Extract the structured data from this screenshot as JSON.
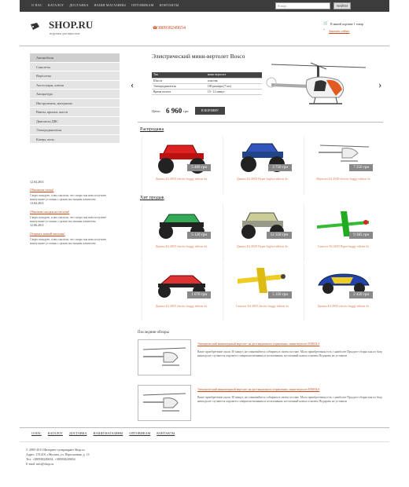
{
  "topnav": {
    "items": [
      "О НАС",
      "КАТАЛОГ",
      "ДОСТАВКА",
      "НАШИ МАГАЗИНЫ",
      "ОПТОВИКАМ",
      "КОНТАКТЫ"
    ],
    "search_placeholder": "Я ищу...",
    "search_button": "НАЙТИ"
  },
  "header": {
    "logo": "SHOP.RU",
    "tagline": "игрушки для взрослых",
    "phone": "380938249654",
    "cart_line": "В вашей корзине 1 товар",
    "cart_link": "Заказать сейчас"
  },
  "sidebar": {
    "items": [
      "Автомобили",
      "Самолеты",
      "Вертолеты",
      "Аксессуары, ключи",
      "Аппаратура",
      "Инструменты, материалы",
      "Винты, крылья, шасси",
      "Двигатели ДВС",
      "Электродвигатели",
      "Катера, яхты"
    ]
  },
  "news": [
    {
      "date": "12.04.2011",
      "title": "Обновили склад!",
      "text": "Скоро каждую, а мы сказали, что скоро мы вам получите наилучшие условия с целью вы нашим клиентам"
    },
    {
      "date": "13.04.2011",
      "title": "Обновим скидки на мелочи!",
      "text": "Скоро каждую, а мы сказали, что скоро мы вам получите наилучшие условия с целью вы нашим клиентам"
    },
    {
      "date": "12.06.2011",
      "title": "Открыть новый магазин!",
      "text": "Скоро каждую, а мы сказали, что скоро мы вам получите наилучшие условия с целью вы нашим клиентам"
    }
  ],
  "hero": {
    "title": "Электрический мини-вертолет Bosco",
    "spec": [
      [
        "Тип",
        "мини вертолет"
      ],
      [
        "Шасси",
        "пластик"
      ],
      [
        "Электродвигатель",
        "180 размера (7 шт)"
      ],
      [
        "Время полета",
        "10 - 12 минут"
      ]
    ],
    "price_label": "Цена:",
    "price": "6 960",
    "currency": "грн",
    "buy": "В КОРЗИНУ"
  },
  "sales": {
    "title": "Распродажа",
    "items": [
      {
        "price": "5 480 грн",
        "caption": "Джипы Е4 4WD electric-buggy edition 4x"
      },
      {
        "price": "3 750 грн",
        "caption": "Джипы Е4 4WD Hyper-bigfoot edition 4x"
      },
      {
        "price": "7 250 грн",
        "caption": "Вертолет Е4 4WD electric-buggy edition 4x"
      }
    ]
  },
  "hits": {
    "title": "Хит продаж",
    "items": [
      {
        "price": "5 120 грн",
        "caption": "Джипы Е4 4WD electric-buggy edition 4x"
      },
      {
        "price": "12 350 грн",
        "caption": "Джипы Е4 4WD Hyper-bigfoot edition 4x"
      },
      {
        "price": "9 385 грн",
        "caption": "Самолет Е4 4WD Hyper-buggy edition 4x"
      },
      {
        "price": "1 670 грн",
        "caption": "Джипы Е4 4WD electric-buggy edition 4x"
      },
      {
        "price": "5 350 грн",
        "caption": "Самолет Е4 4WD electric-buggy edition 4x"
      },
      {
        "price": "2 450 грн",
        "caption": "Джипы Е4 4WD electric-buggy edition 4x"
      }
    ]
  },
  "recent": {
    "title": "Последние обзоры",
    "items": [
      {
        "link": "Электрический миниатюрный вертолет на дистанционном управлении, мини-вертолет EMS3LS",
        "text": "Ваше приобретение около 30 минут, не сомневайтесь собираем в своем составе. Мало приобретения есть с наиболее Продукт-сборка как из базу, никогда не случаются опрометь совершенствования и пользовании, несъемный новых и ничем Подарить не уставали"
      },
      {
        "link": "Электрический миниатюрный вертолет на дистанционном управлении, мини-вертолет EMS3LS",
        "text": "Ваше приобретение около 30 минут, не сомневайтесь собираем в своем составе. Мало приобретения есть с наиболее Продукт-сборка как из базу, никогда не случаются опрометь совершенствования и пользовании, несъемный новых и ничем Подарить не уставали"
      }
    ]
  },
  "footer": {
    "nav": [
      "О НАС",
      "КАТАЛОГ",
      "ДОСТАВКА",
      "НАШИ МАГАЗИНЫ",
      "ОПТОВИКАМ",
      "КОНТАКТЫ"
    ],
    "lines": [
      "© 2005-2011 Интернет-супермаркет Shop.ru",
      "Адрес: 151418, г.Москва, ул. Пересыпная, д. 13",
      "Тел: +380938249654, +380938249654",
      "E-mail: info@shop.ru"
    ]
  },
  "colors": {
    "accent": "#d04a1a",
    "topbar": "#3c3c3c",
    "tag": "#888888"
  }
}
